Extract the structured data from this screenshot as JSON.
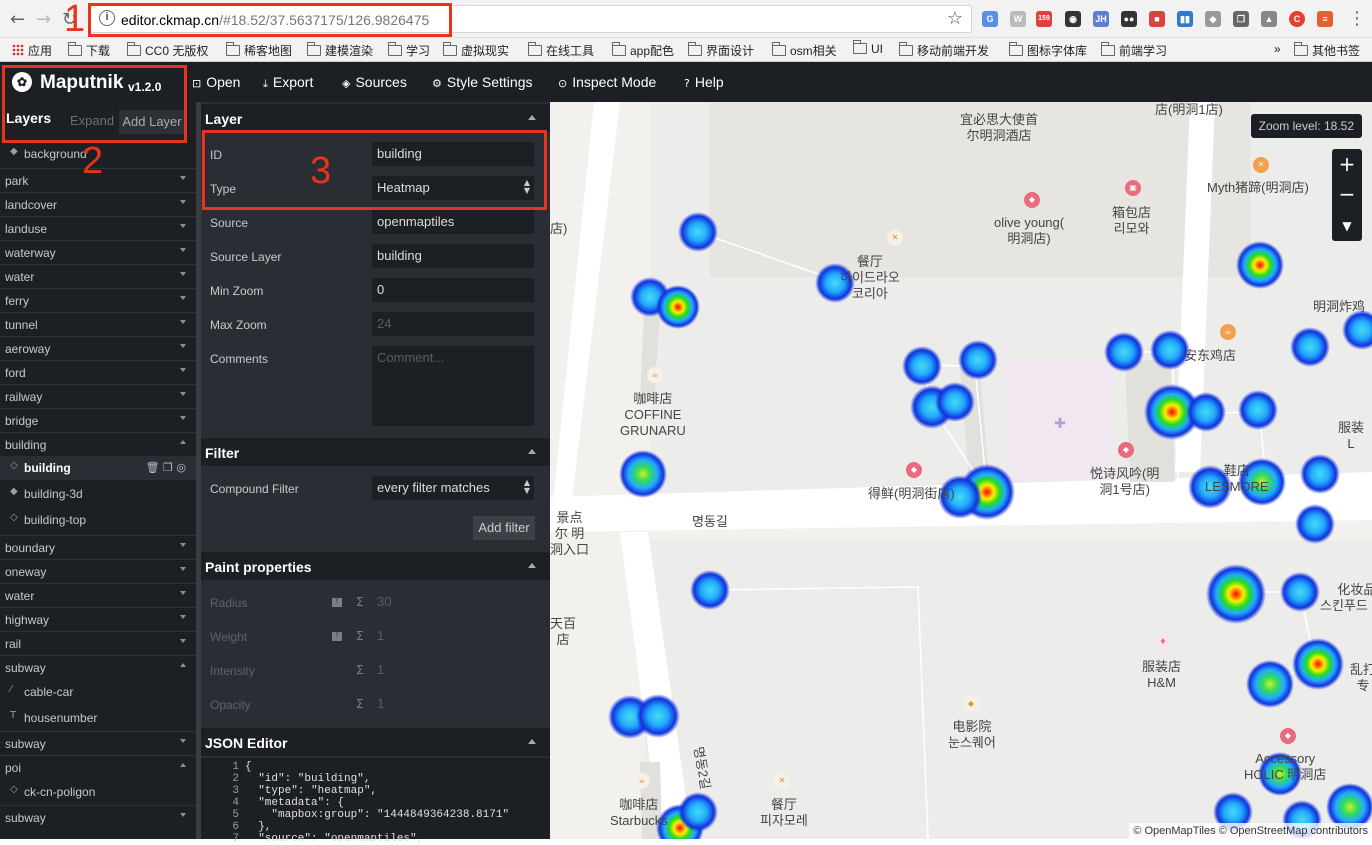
{
  "browser": {
    "url_host": "editor.ckmap.cn",
    "url_path": "/#18.52/37.5637175/126.9826475",
    "bookmarks": [
      "应用",
      "下载",
      "CC0 无版权",
      "稀客地图",
      "建模渲染",
      "学习",
      "虚拟现实",
      "在线工具",
      "app配色",
      "界面设计",
      "osm相关",
      "UI",
      "移动前端开发",
      "图标字体库",
      "前端学习"
    ],
    "bookmarks_more": "»",
    "bookmarks_other": "其他书签",
    "ext_badge": "159"
  },
  "app": {
    "brand": "Maputnik",
    "version": "v1.2.0",
    "toolbar": [
      {
        "label": "Open",
        "icon": "open-icon"
      },
      {
        "label": "Export",
        "icon": "export-icon"
      },
      {
        "label": "Sources",
        "icon": "sources-icon"
      },
      {
        "label": "Style Settings",
        "icon": "gear-icon"
      },
      {
        "label": "Inspect Mode",
        "icon": "inspect-icon"
      },
      {
        "label": "Help",
        "icon": "help-icon"
      }
    ]
  },
  "layers_panel": {
    "title": "Layers",
    "expand": "Expand",
    "add_layer": "Add Layer",
    "rows": [
      {
        "label": "background",
        "kind": "child",
        "icon": "◆"
      },
      {
        "label": "park",
        "kind": "group"
      },
      {
        "label": "landcover",
        "kind": "group"
      },
      {
        "label": "landuse",
        "kind": "group"
      },
      {
        "label": "waterway",
        "kind": "group"
      },
      {
        "label": "water",
        "kind": "group"
      },
      {
        "label": "ferry",
        "kind": "group"
      },
      {
        "label": "tunnel",
        "kind": "group"
      },
      {
        "label": "aeroway",
        "kind": "group"
      },
      {
        "label": "ford",
        "kind": "group"
      },
      {
        "label": "railway",
        "kind": "group"
      },
      {
        "label": "bridge",
        "kind": "group"
      },
      {
        "label": "building",
        "kind": "group",
        "open": true
      },
      {
        "label": "building",
        "kind": "child",
        "icon": "◇",
        "selected": true
      },
      {
        "label": "building-3d",
        "kind": "child",
        "icon": "◆"
      },
      {
        "label": "building-top",
        "kind": "child",
        "icon": "◇"
      },
      {
        "label": "boundary",
        "kind": "group"
      },
      {
        "label": "oneway",
        "kind": "group"
      },
      {
        "label": "water",
        "kind": "group"
      },
      {
        "label": "highway",
        "kind": "group"
      },
      {
        "label": "rail",
        "kind": "group"
      },
      {
        "label": "subway",
        "kind": "group",
        "open": true
      },
      {
        "label": "cable-car",
        "kind": "child",
        "icon": "⁄"
      },
      {
        "label": "housenumber",
        "kind": "child",
        "icon": "T"
      },
      {
        "label": "subway",
        "kind": "group"
      },
      {
        "label": "poi",
        "kind": "group",
        "open": true
      },
      {
        "label": "ck-cn-poligon",
        "kind": "child",
        "icon": "◇"
      },
      {
        "label": "subway",
        "kind": "group"
      }
    ]
  },
  "editor": {
    "layer_title": "Layer",
    "fields": [
      {
        "label": "ID",
        "value": "building"
      },
      {
        "label": "Type",
        "value": "Heatmap",
        "select": true
      },
      {
        "label": "Source",
        "value": "openmaptiles"
      },
      {
        "label": "Source Layer",
        "value": "building"
      },
      {
        "label": "Min Zoom",
        "value": "0"
      },
      {
        "label": "Max Zoom",
        "value": "24",
        "dim": true
      },
      {
        "label": "Comments",
        "value": "Comment...",
        "dim": true,
        "textarea": true
      }
    ],
    "filter_title": "Filter",
    "compound_label": "Compound Filter",
    "compound_value": "every filter matches",
    "add_filter": "Add filter",
    "paint_title": "Paint properties",
    "paint": [
      {
        "label": "Radius",
        "value": "30",
        "fn": true
      },
      {
        "label": "Weight",
        "value": "1",
        "fn": true
      },
      {
        "label": "Intensity",
        "value": "1",
        "fn": false
      },
      {
        "label": "Opacity",
        "value": "1",
        "fn": false
      }
    ],
    "sigma": "Σ",
    "json_title": "JSON Editor",
    "json_lines": [
      {
        "n": "1",
        "t": "{"
      },
      {
        "n": "2",
        "t": "  \"id\": \"building\","
      },
      {
        "n": "3",
        "t": "  \"type\": \"heatmap\","
      },
      {
        "n": "4",
        "t": "  \"metadata\": {"
      },
      {
        "n": "5",
        "t": "    \"mapbox:group\": \"1444849364238.8171\""
      },
      {
        "n": "6",
        "t": "  },"
      },
      {
        "n": "7",
        "t": "  \"source\": \"openmaptiles\","
      }
    ]
  },
  "map": {
    "zoom_label": "Zoom level: 18.52",
    "attribution": "© OpenMapTiles © OpenStreetMap contributors",
    "labels": [
      {
        "t": "宜必思大使首\n尔明洞酒店"
      },
      {
        "t": "店(明洞1店)"
      },
      {
        "t": "Myth猪蹄(明洞店)"
      },
      {
        "t": "olive young(\n明洞店)"
      },
      {
        "t": "箱包店\n리모와"
      },
      {
        "t": "餐厅\n하이드라오\n코리아"
      },
      {
        "t": "店)"
      },
      {
        "t": "明洞炸鸡"
      },
      {
        "t": "安东鸡店"
      },
      {
        "t": "咖啡店\nCOFFINE\nGRUNARU"
      },
      {
        "t": "服装\nL"
      },
      {
        "t": "悦诗风吟(明\n洞1号店)"
      },
      {
        "t": "鞋店\nLESMORE"
      },
      {
        "t": "得鲜(明洞街店)"
      },
      {
        "t": "景点\n尔 明\n洞入口"
      },
      {
        "t": "명동길"
      },
      {
        "t": "化妆品\n스킨푸드 (Ski"
      },
      {
        "t": "天百\n店"
      },
      {
        "t": "服装店\nH&M"
      },
      {
        "t": "乱打\n专"
      },
      {
        "t": "电影院\n눈스퀘어"
      },
      {
        "t": "Accessory\nHOLIC 明洞店"
      },
      {
        "t": "咖啡店\nStarbucks"
      },
      {
        "t": "餐厅\n피자모레"
      },
      {
        "t": "명동2길"
      }
    ]
  },
  "annotations": [
    "1",
    "2",
    "3"
  ]
}
